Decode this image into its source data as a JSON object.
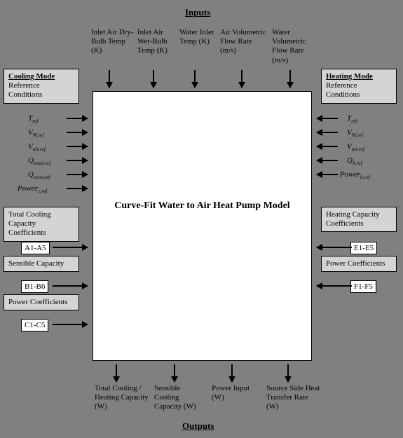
{
  "titles": {
    "inputs": "Inputs",
    "outputs": "Outputs"
  },
  "top_inputs": [
    "Inlet Air Dry-Bulb Temp (K)",
    "Inlet Air Wet-Bulb Temp (K)",
    "Water Inlet Temp (K)",
    "Air Volumetric Flow Rate (m/s)",
    "Water Volumetric Flow Rate (m/s)"
  ],
  "cooling_mode": {
    "heading": "Cooling Mode",
    "sub": "Reference Conditions",
    "refs": [
      "T_ref",
      "Vdot_W,ref",
      "Vdot_air,ref",
      "Q_total,ref",
      "Q_sens,ref",
      "Power_c,ref"
    ],
    "boxes": {
      "tcc": "Total Cooling Capacity Coefficients",
      "sc": "Sensible Capacity",
      "pc": "Power Coefficients"
    },
    "ranges": {
      "a": "A1-A5",
      "b": "B1-B6",
      "c": "C1-C5"
    }
  },
  "heating_mode": {
    "heading": "Heating Mode",
    "sub": "Reference Conditions",
    "refs": [
      "T_ref",
      "Vdot_W,ref",
      "Vdot_air,ref",
      "Q_h,ref",
      "Power_h,ref"
    ],
    "boxes": {
      "hcc": "Heating Capacity Coefficients",
      "pc": "Power Coefficients"
    },
    "ranges": {
      "e": "E1-E5",
      "f": "F1-F5"
    }
  },
  "model_title": "Curve-Fit Water to Air Heat Pump Model",
  "outputs": [
    "Total Cooling / Heating Capacity (W)",
    "Sensible Cooling Capacity (W)",
    "Power Input (W)",
    "Source Side Heat Transfer Rate (W)"
  ],
  "chart_data": {
    "type": "table",
    "title": "Curve-Fit Water to Air Heat Pump Model — inputs vs outputs diagram",
    "inputs_top": [
      {
        "name": "Inlet Air Dry-Bulb Temp",
        "unit": "K"
      },
      {
        "name": "Inlet Air Wet-Bulb Temp",
        "unit": "K"
      },
      {
        "name": "Water Inlet Temp",
        "unit": "K"
      },
      {
        "name": "Air Volumetric Flow Rate",
        "unit": "m/s"
      },
      {
        "name": "Water Volumetric Flow Rate",
        "unit": "m/s"
      }
    ],
    "cooling_side": {
      "reference_conditions": [
        "T_ref",
        "Vdot_W,ref",
        "Vdot_air,ref",
        "Q_total,ref",
        "Q_sens,ref",
        "Power_c,ref"
      ],
      "coefficient_groups": [
        {
          "name": "Total Cooling Capacity Coefficients",
          "range": "A1-A5"
        },
        {
          "name": "Sensible Capacity",
          "range": "B1-B6"
        },
        {
          "name": "Power Coefficients",
          "range": "C1-C5"
        }
      ]
    },
    "heating_side": {
      "reference_conditions": [
        "T_ref",
        "Vdot_W,ref",
        "Vdot_air,ref",
        "Q_h,ref",
        "Power_h,ref"
      ],
      "coefficient_groups": [
        {
          "name": "Heating Capacity Coefficients",
          "range": "E1-E5"
        },
        {
          "name": "Power Coefficients",
          "range": "F1-F5"
        }
      ]
    },
    "outputs": [
      {
        "name": "Total Cooling / Heating Capacity",
        "unit": "W"
      },
      {
        "name": "Sensible Cooling Capacity",
        "unit": "W"
      },
      {
        "name": "Power Input",
        "unit": "W"
      },
      {
        "name": "Source Side Heat Transfer Rate",
        "unit": "W"
      }
    ]
  }
}
